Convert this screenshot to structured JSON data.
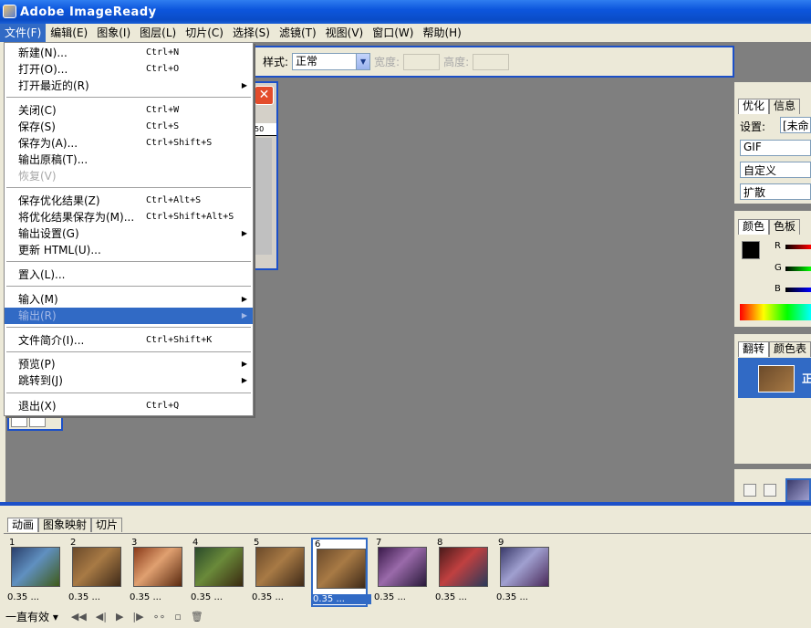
{
  "window": {
    "title": "Adobe ImageReady"
  },
  "menubar": [
    "文件(F)",
    "编辑(E)",
    "图象(I)",
    "图层(L)",
    "切片(C)",
    "选择(S)",
    "滤镜(T)",
    "视图(V)",
    "窗口(W)",
    "帮助(H)"
  ],
  "file_menu": {
    "items": [
      {
        "label": "新建(N)...",
        "shortcut": "Ctrl+N"
      },
      {
        "label": "打开(O)...",
        "shortcut": "Ctrl+O"
      },
      {
        "label": "打开最近的(R)",
        "submenu": true
      },
      {
        "label": "关闭(C)",
        "shortcut": "Ctrl+W"
      },
      {
        "label": "保存(S)",
        "shortcut": "Ctrl+S"
      },
      {
        "label": "保存为(A)...",
        "shortcut": "Ctrl+Shift+S"
      },
      {
        "label": "输出原稿(T)..."
      },
      {
        "label": "恢复(V)",
        "disabled": true
      },
      {
        "label": "保存优化结果(Z)",
        "shortcut": "Ctrl+Alt+S"
      },
      {
        "label": "将优化结果保存为(M)...",
        "shortcut": "Ctrl+Shift+Alt+S"
      },
      {
        "label": "输出设置(G)",
        "submenu": true
      },
      {
        "label": "更新 HTML(U)..."
      },
      {
        "label": "置入(L)..."
      },
      {
        "label": "输入(M)",
        "submenu": true
      },
      {
        "label": "输出(R)",
        "submenu": true,
        "disabled": true,
        "highlighted": true
      },
      {
        "label": "文件简介(I)...",
        "shortcut": "Ctrl+Shift+K"
      },
      {
        "label": "预览(P)",
        "submenu": true
      },
      {
        "label": "跳转到(J)",
        "submenu": true
      },
      {
        "label": "退出(X)",
        "shortcut": "Ctrl+Q"
      }
    ]
  },
  "options_bar": {
    "style_label": "样式:",
    "style_value": "正常",
    "width_label": "宽度:",
    "height_label": "高度:"
  },
  "doc_window": {
    "ruler_tick": "50",
    "close_symbol": "✕"
  },
  "right_panels": {
    "optimize": {
      "tabs": [
        "优化",
        "信息"
      ],
      "settings_label": "设置:",
      "settings_value": "[未命",
      "format": "GIF",
      "palette": "自定义",
      "dither": "扩散"
    },
    "color": {
      "tabs": [
        "颜色",
        "色板"
      ],
      "channels": [
        "R",
        "G",
        "B"
      ]
    },
    "history": {
      "tabs": [
        "翻转",
        "颜色表"
      ],
      "row_label": "正"
    }
  },
  "animation": {
    "tabs": [
      "动画",
      "图象映射",
      "切片"
    ],
    "frames": [
      {
        "number": "1",
        "delay": "0.35 ..."
      },
      {
        "number": "2",
        "delay": "0.35 ..."
      },
      {
        "number": "3",
        "delay": "0.35 ..."
      },
      {
        "number": "4",
        "delay": "0.35 ..."
      },
      {
        "number": "5",
        "delay": "0.35 ..."
      },
      {
        "number": "6",
        "delay": "0.35 ...",
        "selected": true
      },
      {
        "number": "7",
        "delay": "0.35 ..."
      },
      {
        "number": "8",
        "delay": "0.35 ..."
      },
      {
        "number": "9",
        "delay": "0.35 ..."
      }
    ],
    "loop_value": "一直有效"
  }
}
